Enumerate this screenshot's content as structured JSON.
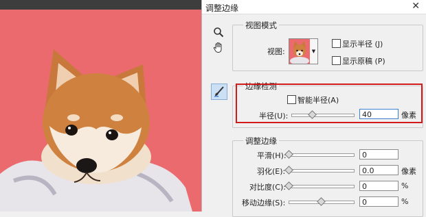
{
  "window": {
    "title": "调整边缘",
    "close_glyph": "✕"
  },
  "tools": [
    "zoom-icon",
    "hand-icon",
    "refine-radius-brush-icon"
  ],
  "view_mode": {
    "legend": "视图模式",
    "view_label": "视图:",
    "show_radius": {
      "label": "显示半径 (J)",
      "checked": false
    },
    "show_original": {
      "label": "显示原稿 (P)",
      "checked": false
    }
  },
  "edge_detection": {
    "legend": "边缘检测",
    "smart_radius": {
      "label": "智能半径(A)",
      "checked": false
    },
    "radius": {
      "label": "半径(U):",
      "value": "40",
      "unit": "像素",
      "slider_pct": 0.33
    }
  },
  "adjust_edge": {
    "legend": "调整边缘",
    "rows": [
      {
        "label": "平滑(H):",
        "value": "0",
        "unit": "",
        "slider_pct": 0.0
      },
      {
        "label": "羽化(E):",
        "value": "0.0",
        "unit": "像素",
        "slider_pct": 0.0
      },
      {
        "label": "对比度(C):",
        "value": "0",
        "unit": "%",
        "slider_pct": 0.0
      },
      {
        "label": "移动边缘(S):",
        "value": "0",
        "unit": "%",
        "slider_pct": 0.5
      }
    ]
  },
  "colors": {
    "canvas_bg": "#ea6a6e",
    "highlight_box": "#d31a1a",
    "accent": "#3c7fd0"
  }
}
